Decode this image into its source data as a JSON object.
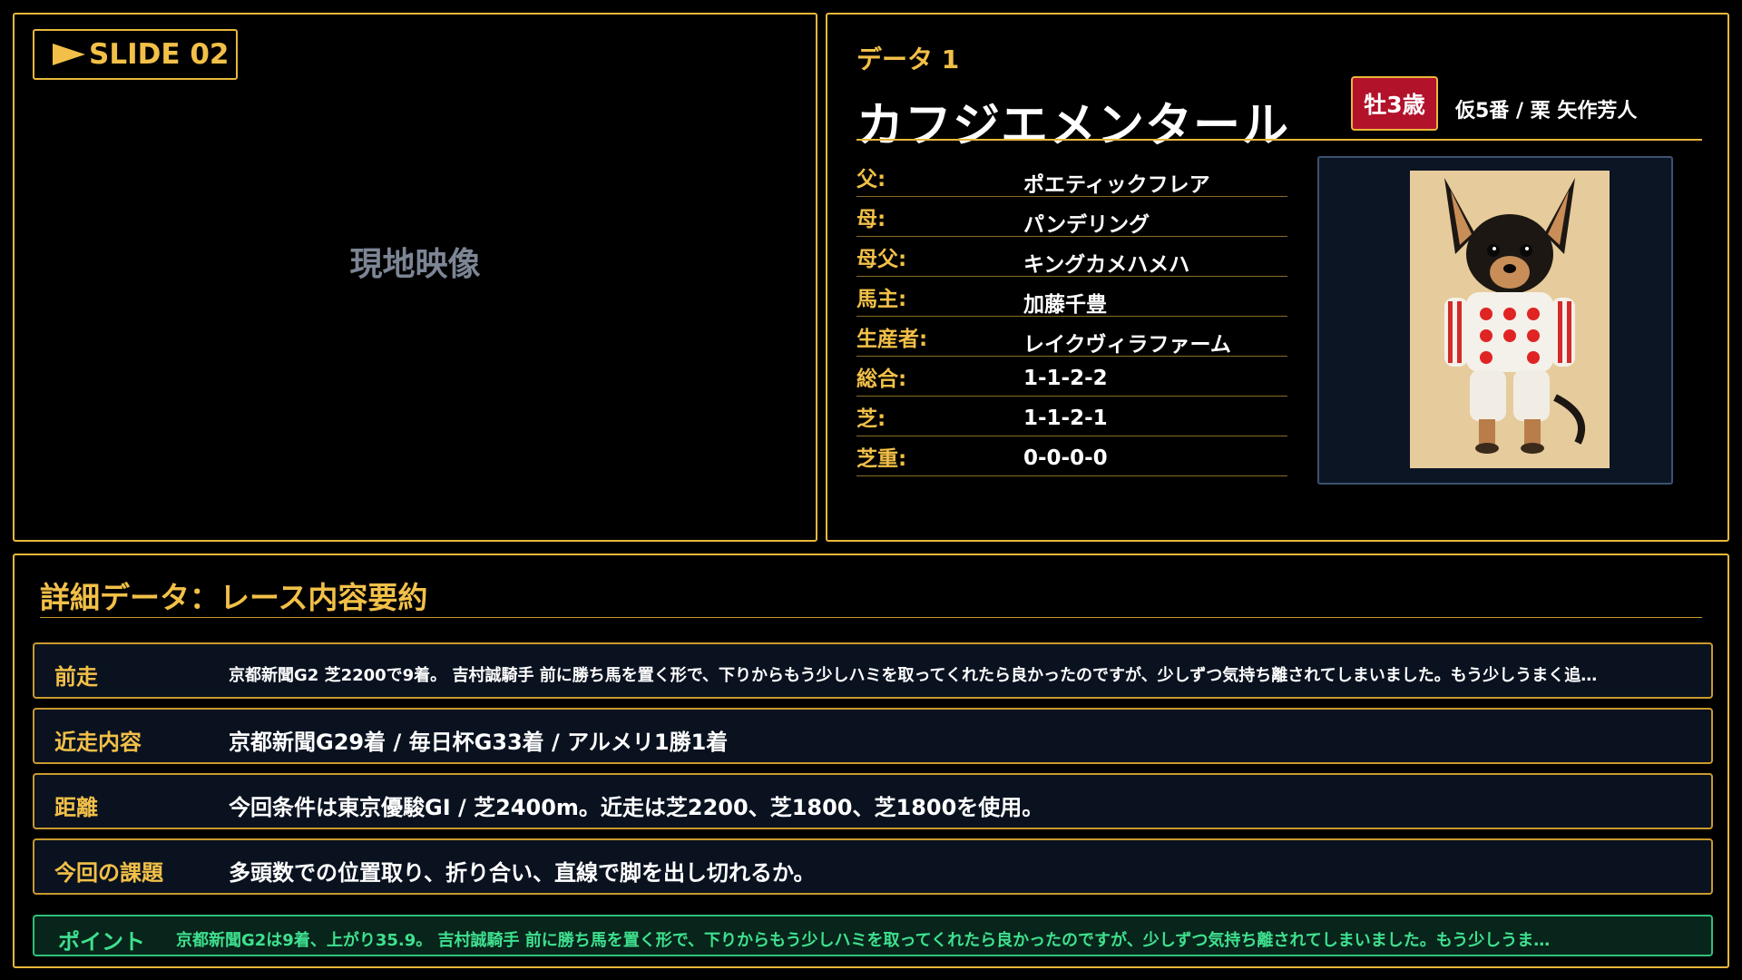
{
  "slide": {
    "label": "SLIDE 02",
    "video_placeholder": "現地映像"
  },
  "profile": {
    "data_label": "データ 1",
    "name": "カフジエメンタール",
    "sex_age": "牡3歳",
    "meta": "仮5番 / 栗 矢作芳人",
    "info": [
      {
        "key": "父:",
        "value": "ポエティックフレア"
      },
      {
        "key": "母:",
        "value": "パンデリング"
      },
      {
        "key": "母父:",
        "value": "キングカメハメハ"
      },
      {
        "key": "馬主:",
        "value": "加藤千豊"
      },
      {
        "key": "生産者:",
        "value": "レイクヴィラファーム"
      },
      {
        "key": "総合:",
        "value": "1-1-2-2"
      },
      {
        "key": "芝:",
        "value": "1-1-2-1"
      },
      {
        "key": "芝重:",
        "value": "0-0-0-0"
      }
    ]
  },
  "detail": {
    "title": "詳細データ：レース内容要約",
    "rows": [
      {
        "label": "前走",
        "value": "京都新聞G2 芝2200で9着。 吉村誠騎手 前に勝ち馬を置く形で、下りからもう少しハミを取ってくれたら良かったのですが、少しずつ気持ち離されてしまいました。もう少しうまく追…"
      },
      {
        "label": "近走内容",
        "value": "京都新聞G29着 / 毎日杯G33着 / アルメリ1勝1着"
      },
      {
        "label": "距離",
        "value": "今回条件は東京優駿GI / 芝2400m。近走は芝2200、芝1800、芝1800を使用。"
      },
      {
        "label": "今回の課題",
        "value": "多頭数での位置取り、折り合い、直線で脚を出し切れるか。"
      }
    ],
    "point_label": "ポイント",
    "point_text": "京都新聞G2は9着、上がり35.9。 吉村誠騎手 前に勝ち馬を置く形で、下りからもう少しハミを取ってくれたら良かったのですが、少しずつ気持ち離されてしまいました。もう少しうま…"
  },
  "colors": {
    "accent": "#e8b83a",
    "badge": "#b3122b",
    "point": "#3fe08f"
  }
}
